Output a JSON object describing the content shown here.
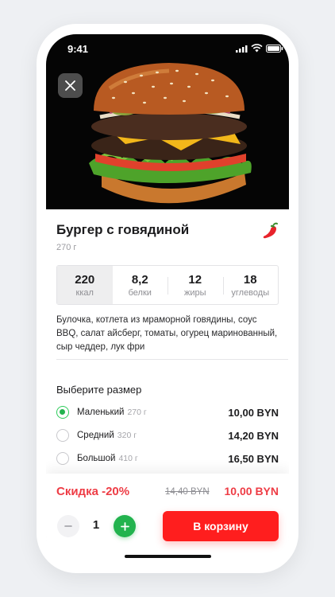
{
  "status_bar": {
    "time": "9:41"
  },
  "product": {
    "title": "Бургер с говядиной",
    "weight": "270 г",
    "description": "Булочка, котлета из мраморной говядины, соус BBQ, салат айсберг, томаты, огурец маринованный, сыр чеддер, лук фри",
    "spicy_icon": "chili-pepper-icon"
  },
  "nutrition": [
    {
      "value": "220",
      "label": "ккал",
      "selected": true
    },
    {
      "value": "8,2",
      "label": "белки",
      "selected": false
    },
    {
      "value": "12",
      "label": "жиры",
      "selected": false
    },
    {
      "value": "18",
      "label": "углеводы",
      "selected": false
    }
  ],
  "size": {
    "title": "Выберите размер",
    "options": [
      {
        "name": "Маленький",
        "weight": "270 г",
        "price": "10,00 BYN",
        "selected": true
      },
      {
        "name": "Средний",
        "weight": "320 г",
        "price": "14,20 BYN",
        "selected": false
      },
      {
        "name": "Большой",
        "weight": "410 г",
        "price": "16,50 BYN",
        "selected": false
      }
    ]
  },
  "order": {
    "discount_label": "Скидка -20%",
    "old_price": "14,40 BYN",
    "new_price": "10,00 BYN",
    "quantity": "1",
    "cart_button": "В корзину"
  },
  "colors": {
    "accent_red": "#ff1e1e",
    "discount_red": "#ee3c45",
    "green": "#22b34e"
  }
}
